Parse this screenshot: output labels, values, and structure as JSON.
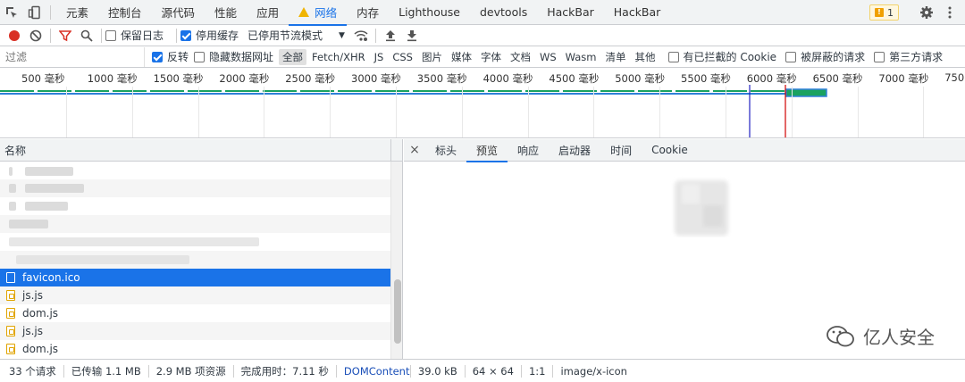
{
  "tabs": [
    "元素",
    "控制台",
    "源代码",
    "性能",
    "应用",
    "网络",
    "内存",
    "Lighthouse",
    "devtools",
    "HackBar",
    "HackBar"
  ],
  "active_tab": "网络",
  "issues_count": "1",
  "toolbar": {
    "preserve_log": "保留日志",
    "disable_cache": "停用缓存",
    "throttle": "已停用节流模式"
  },
  "filter": {
    "placeholder": "过滤",
    "invert": "反转",
    "hide_data_urls": "隐藏数据网址",
    "types": [
      "全部",
      "Fetch/XHR",
      "JS",
      "CSS",
      "图片",
      "媒体",
      "字体",
      "文档",
      "WS",
      "Wasm",
      "清单",
      "其他"
    ],
    "blocked_cookies": "有已拦截的 Cookie",
    "blocked_requests": "被屏蔽的请求",
    "third_party": "第三方请求"
  },
  "timeline_ticks": [
    "500 毫秒",
    "1000 毫秒",
    "1500 毫秒",
    "2000 毫秒",
    "2500 毫秒",
    "3000 毫秒",
    "3500 毫秒",
    "4000 毫秒",
    "4500 毫秒",
    "5000 毫秒",
    "5500 毫秒",
    "6000 毫秒",
    "6500 毫秒",
    "7000 毫秒",
    "750"
  ],
  "requests": {
    "header": "名称",
    "files": [
      {
        "name": "favicon.ico",
        "type": "ico"
      },
      {
        "name": "js.js",
        "type": "js"
      },
      {
        "name": "dom.js",
        "type": "js"
      },
      {
        "name": "js.js",
        "type": "js"
      },
      {
        "name": "dom.js",
        "type": "js"
      }
    ]
  },
  "details": {
    "close": "×",
    "tabs": [
      "标头",
      "预览",
      "响应",
      "启动器",
      "时间",
      "Cookie"
    ],
    "active": "预览"
  },
  "watermark": "亿人安全",
  "status": {
    "requests": "33 个请求",
    "transferred": "已传输 1.1 MB",
    "resources": "2.9 MB 项资源",
    "finish": "完成用时：7.11 秒",
    "domcontent": "DOMContentL",
    "size": "39.0 kB",
    "dims": "64 × 64",
    "ratio": "1:1",
    "mime": "image/x-icon"
  },
  "colors": {
    "accent": "#1a73e8",
    "record": "#d93025",
    "filter": "#d93025"
  }
}
